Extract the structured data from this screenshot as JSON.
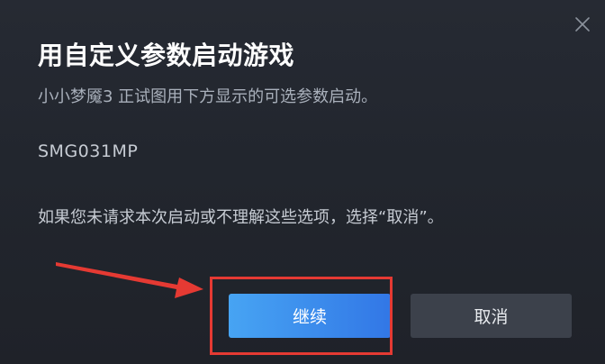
{
  "dialog": {
    "title": "用自定义参数启动游戏",
    "subtitle": "小小梦魇3 正试图用下方显示的可选参数启动。",
    "launch_params": "SMG031MP",
    "notice": "如果您未请求本次启动或不理解这些选项，选择“取消”。",
    "continue_label": "继续",
    "cancel_label": "取消"
  },
  "icons": {
    "close": "close-icon",
    "annotation_arrow": "red-arrow-icon"
  },
  "colors": {
    "continue_button": "#3b8ff0",
    "cancel_button": "#3c414b",
    "highlight": "#e53a33"
  }
}
